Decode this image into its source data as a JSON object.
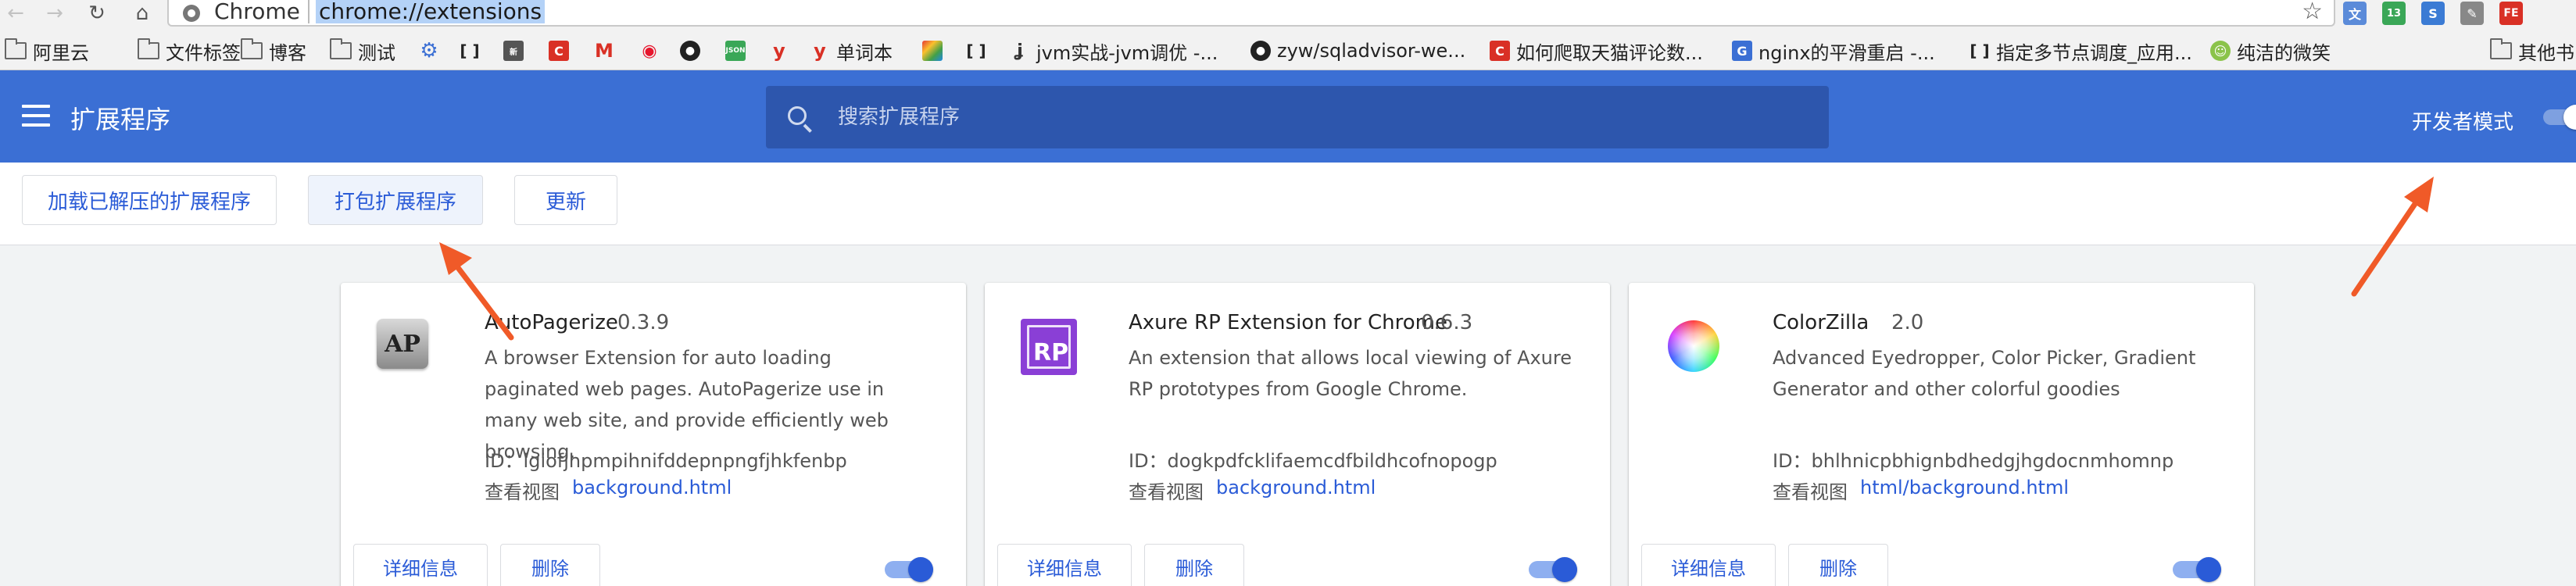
{
  "browser": {
    "site_label": "Chrome",
    "url": "chrome://extensions",
    "extension_icons": [
      {
        "name": "translate-icon",
        "color": "#5b8bd9",
        "text": "文"
      },
      {
        "name": "download-icon",
        "color": "#3aa757",
        "text": "13"
      },
      {
        "name": "s-icon",
        "color": "#3b7bd4",
        "text": "S"
      },
      {
        "name": "pen-icon",
        "color": "#888888",
        "text": "✎"
      },
      {
        "name": "fe-icon",
        "color": "#d93025",
        "text": "FE"
      }
    ]
  },
  "bookmarks": [
    {
      "label": "阿里云",
      "icon": "folder-icon"
    },
    {
      "label": "文件标签",
      "icon": "folder-icon"
    },
    {
      "label": "博客",
      "icon": "folder-icon"
    },
    {
      "label": "测试",
      "icon": "folder-icon"
    },
    {
      "label": "",
      "icon": "gear-icon"
    },
    {
      "label": "",
      "icon": "code-icon"
    },
    {
      "label": "",
      "icon": "news-icon"
    },
    {
      "label": "",
      "icon": "c-icon"
    },
    {
      "label": "",
      "icon": "gmail-icon"
    },
    {
      "label": "",
      "icon": "weibo-icon"
    },
    {
      "label": "",
      "icon": "github-icon"
    },
    {
      "label": "",
      "icon": "json-icon"
    },
    {
      "label": "",
      "icon": "y-icon"
    },
    {
      "label": "单词本",
      "icon": "y-icon"
    },
    {
      "label": "",
      "icon": "rainbow-icon"
    },
    {
      "label": "",
      "icon": "code-icon"
    },
    {
      "label": "jvm实战-jvm调优 -...",
      "icon": "j-icon"
    },
    {
      "label": "zyw/sqladvisor-we...",
      "icon": "github-icon"
    },
    {
      "label": "如何爬取天猫评论数...",
      "icon": "c-icon"
    },
    {
      "label": "nginx的平滑重启 -...",
      "icon": "g-icon"
    },
    {
      "label": "指定多节点调度_应用...",
      "icon": "code-icon"
    },
    {
      "label": "纯洁的微笑",
      "icon": "smile-icon"
    },
    {
      "label": "其他书",
      "icon": "folder-icon"
    }
  ],
  "header": {
    "title": "扩展程序",
    "search_placeholder": "搜索扩展程序",
    "dev_mode_label": "开发者模式"
  },
  "toolbar": {
    "load_unpacked": "加载已解压的扩展程序",
    "pack": "打包扩展程序",
    "update": "更新"
  },
  "extensions": [
    {
      "name": "AutoPagerize",
      "version": "0.3.9",
      "description": "A browser Extension for auto loading paginated web pages. AutoPagerize use in many web site, and provide efficiently web browsing.",
      "id_label": "ID：igiofjhpmpihnifddepnpngfjhkfenbp",
      "view_label": "查看视图",
      "view_link": "background.html",
      "details": "详细信息",
      "remove": "删除",
      "icon_text": "AP",
      "enabled": true
    },
    {
      "name": "Axure RP Extension for Chrome",
      "version": "0.6.3",
      "description": "An extension that allows local viewing of Axure RP prototypes from Google Chrome.",
      "id_label": "ID：dogkpdfcklifaemcdfbildhcofnopogp",
      "view_label": "查看视图",
      "view_link": "background.html",
      "details": "详细信息",
      "remove": "删除",
      "icon_text": "RP",
      "enabled": true
    },
    {
      "name": "ColorZilla",
      "version": "2.0",
      "description": "Advanced Eyedropper, Color Picker, Gradient Generator and other colorful goodies",
      "id_label": "ID：bhlhnicpbhignbdhedgjhgdocnmhomnp",
      "view_label": "查看视图",
      "view_link": "html/background.html",
      "details": "详细信息",
      "remove": "删除",
      "icon_text": "",
      "enabled": true
    }
  ],
  "colors": {
    "header_blue": "#3b6fd4",
    "search_blue": "#2d56ad",
    "link_blue": "#2a5bd7",
    "arrow_orange": "#f05a28"
  }
}
